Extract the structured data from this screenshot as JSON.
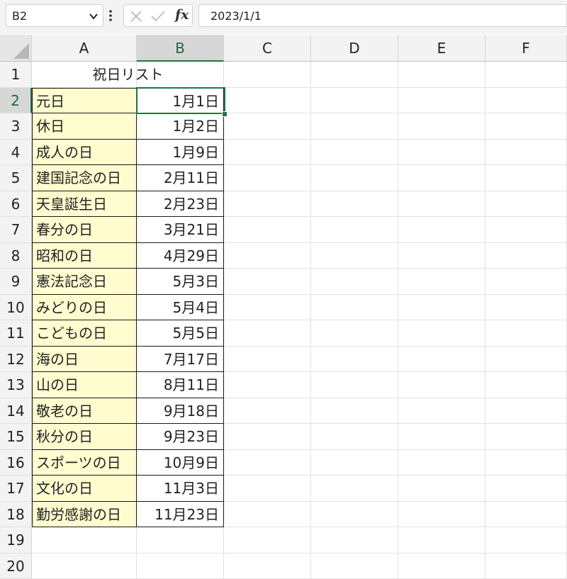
{
  "formula_bar": {
    "name_box": "B2",
    "fx_label": "fx",
    "formula_value": "2023/1/1"
  },
  "columns": [
    "A",
    "B",
    "C",
    "D",
    "E",
    "F"
  ],
  "rows": [
    "1",
    "2",
    "3",
    "4",
    "5",
    "6",
    "7",
    "8",
    "9",
    "10",
    "11",
    "12",
    "13",
    "14",
    "15",
    "16",
    "17",
    "18",
    "19",
    "20"
  ],
  "sheet": {
    "title": "祝日リスト",
    "holidays": [
      {
        "name": "元日",
        "date": "1月1日"
      },
      {
        "name": "休日",
        "date": "1月2日"
      },
      {
        "name": "成人の日",
        "date": "1月9日"
      },
      {
        "name": "建国記念の日",
        "date": "2月11日"
      },
      {
        "name": "天皇誕生日",
        "date": "2月23日"
      },
      {
        "name": "春分の日",
        "date": "3月21日"
      },
      {
        "name": "昭和の日",
        "date": "4月29日"
      },
      {
        "name": "憲法記念日",
        "date": "5月3日"
      },
      {
        "name": "みどりの日",
        "date": "5月4日"
      },
      {
        "name": "こどもの日",
        "date": "5月5日"
      },
      {
        "name": "海の日",
        "date": "7月17日"
      },
      {
        "name": "山の日",
        "date": "8月11日"
      },
      {
        "name": "敬老の日",
        "date": "9月18日"
      },
      {
        "name": "秋分の日",
        "date": "9月23日"
      },
      {
        "name": "スポーツの日",
        "date": "10月9日"
      },
      {
        "name": "文化の日",
        "date": "11月3日"
      },
      {
        "name": "勤労感謝の日",
        "date": "11月23日"
      }
    ]
  },
  "colors": {
    "accent": "#217346",
    "name_cell_fill": "#fffdd0"
  },
  "icons": [
    "chevron-down-icon",
    "more-options-icon",
    "cancel-icon",
    "enter-icon",
    "select-all-icon"
  ]
}
